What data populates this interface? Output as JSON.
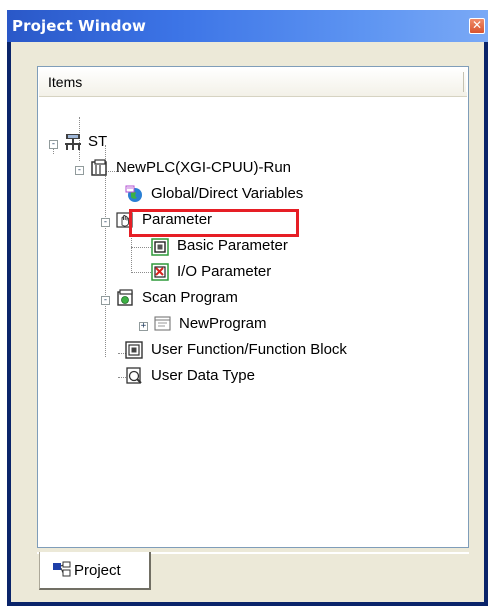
{
  "window": {
    "title": "Project Window",
    "close_glyph": "✕"
  },
  "panel": {
    "column_header": "Items"
  },
  "tree": {
    "root": "ST",
    "plc": "NewPLC(XGI-CPUU)-Run",
    "global_vars": "Global/Direct Variables",
    "parameter": "Parameter",
    "basic_parameter": "Basic Parameter",
    "io_parameter": "I/O Parameter",
    "scan_program": "Scan Program",
    "new_program": "NewProgram",
    "user_function": "User Function/Function Block",
    "user_data_type": "User Data Type"
  },
  "tabs": {
    "project": "Project"
  },
  "icons": {
    "root": "network-icon",
    "plc": "plc-cpu-icon",
    "global_vars": "globe-icon",
    "parameter": "hand-icon",
    "basic_parameter": "basic-param-icon",
    "io_parameter": "io-param-icon",
    "scan_program": "scan-program-icon",
    "new_program": "program-icon",
    "user_function": "function-block-icon",
    "user_data_type": "data-type-icon"
  },
  "colors": {
    "title_bar": "#3c74e6",
    "highlight": "#e61e25",
    "panel_bg": "#ece9d8"
  }
}
